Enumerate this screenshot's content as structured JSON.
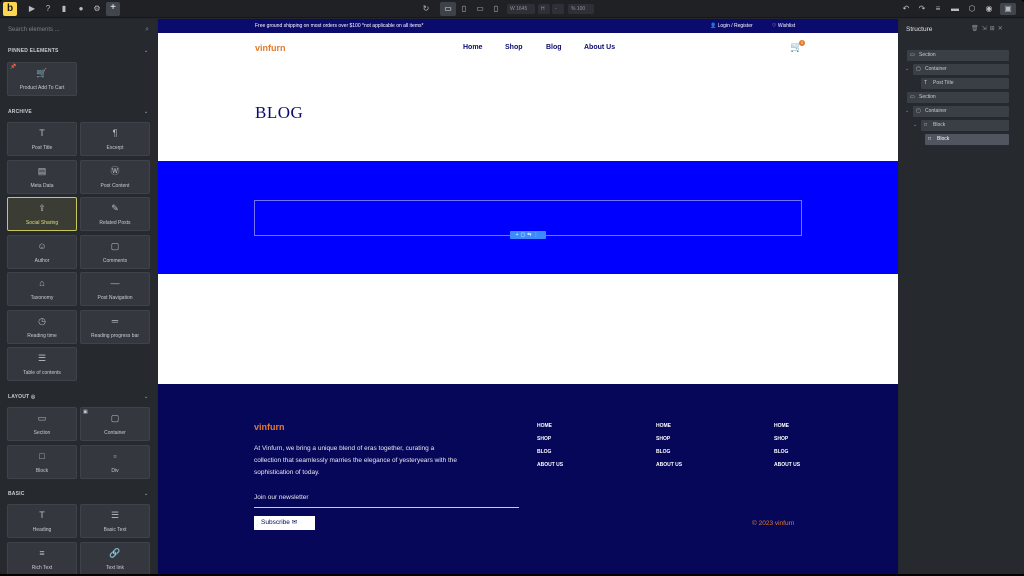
{
  "toolbar": {
    "logo": "b",
    "width_value": "1645",
    "zoom_value": "100"
  },
  "left_panel": {
    "search_placeholder": "Search elements ...",
    "groups": {
      "pinned": "PINNED ELEMENTS",
      "archive": "ARCHIVE",
      "layout": "LAYOUT",
      "basic": "BASIC"
    },
    "pinned": [
      {
        "label": "Product Add To Cart",
        "icon": "cart-icon"
      }
    ],
    "archive": [
      {
        "label": "Post Title",
        "icon": "text-icon"
      },
      {
        "label": "Excerpt",
        "icon": "paragraph-icon"
      },
      {
        "label": "Meta Data",
        "icon": "meta-icon"
      },
      {
        "label": "Post Content",
        "icon": "wordpress-icon"
      },
      {
        "label": "Social Sharing",
        "icon": "share-icon"
      },
      {
        "label": "Related Posts",
        "icon": "pin-icon"
      },
      {
        "label": "Author",
        "icon": "user-icon"
      },
      {
        "label": "Comments",
        "icon": "comment-icon"
      },
      {
        "label": "Taxonomy",
        "icon": "tag-icon"
      },
      {
        "label": "Post Navigation",
        "icon": "navigation-icon"
      },
      {
        "label": "Reading time",
        "icon": "clock-icon"
      },
      {
        "label": "Reading progress bar",
        "icon": "progress-icon"
      },
      {
        "label": "Table of contents",
        "icon": "list-icon"
      }
    ],
    "layout": [
      {
        "label": "Section",
        "icon": "section-icon"
      },
      {
        "label": "Container",
        "icon": "container-icon"
      },
      {
        "label": "Block",
        "icon": "block-icon"
      },
      {
        "label": "Div",
        "icon": "div-icon"
      }
    ],
    "basic": [
      {
        "label": "Heading",
        "icon": "heading-icon"
      },
      {
        "label": "Basic Text",
        "icon": "text-lines-icon"
      },
      {
        "label": "Rich Text",
        "icon": "rich-text-icon"
      },
      {
        "label": "Text link",
        "icon": "link-icon"
      }
    ]
  },
  "site": {
    "announcement": "Free ground shipping on most orders over $100 *not applicable on all items*",
    "login": "Login / Register",
    "wishlist": "Wishlist",
    "brand": "vinfurn",
    "nav": [
      "Home",
      "Shop",
      "Blog",
      "About Us"
    ],
    "cart_count": "0",
    "page_title": "BLOG",
    "footer": {
      "brand": "vinfurn",
      "about": "At Vinfurn, we bring a unique blend of eras together, curating a collection that seamlessly marries the elegance of yesteryears with the sophistication of today.",
      "newsletter": "Join our newsletter",
      "subscribe": "Subscribe",
      "columns": [
        [
          "HOME",
          "SHOP",
          "BLOG",
          "ABOUT US"
        ],
        [
          "HOME",
          "SHOP",
          "BLOG",
          "ABOUT US"
        ],
        [
          "HOME",
          "SHOP",
          "BLOG",
          "ABOUT US"
        ]
      ],
      "copyright": "© 2023 vinfurn"
    }
  },
  "structure": {
    "title": "Structure",
    "tree": [
      {
        "label": "Section"
      },
      {
        "label": "Container"
      },
      {
        "label": "Post Title"
      },
      {
        "label": "Section"
      },
      {
        "label": "Container"
      },
      {
        "label": "Block"
      },
      {
        "label": "Block"
      }
    ]
  },
  "colors": {
    "accent": "#ffd64f",
    "brand_orange": "#e27a2a",
    "navy": "#0b0b6e",
    "blue_section": "#0000ff",
    "footer_bg": "#07075a"
  }
}
